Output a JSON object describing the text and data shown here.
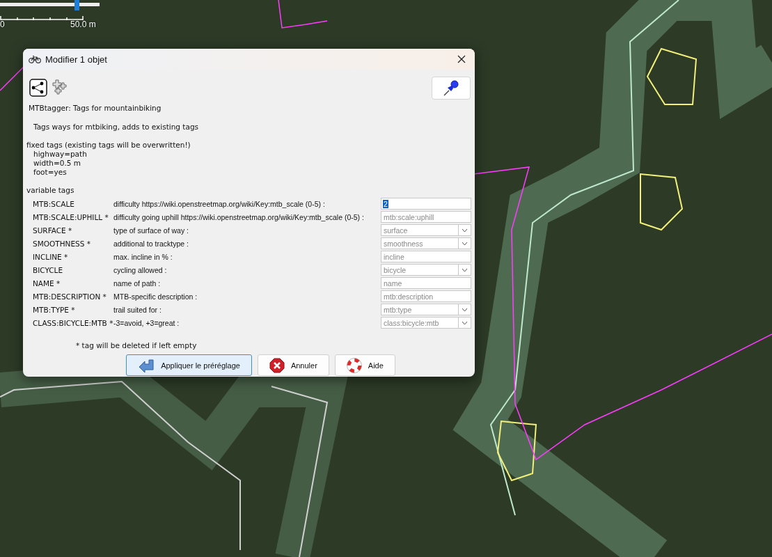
{
  "map": {
    "zoom_slider": {
      "level": 0.77
    },
    "scale": {
      "start": "0",
      "end": "50.0 m"
    }
  },
  "dialog": {
    "title": "Modifier 1 objet",
    "sticky": true,
    "heading": "MTBtagger: Tags for mountainbiking",
    "description": "Tags ways for mtbiking, adds to existing tags",
    "fixed_title": "fixed tags (existing tags will be overwritten!)",
    "fixed_tags": [
      "highway=path",
      "width=0.5 m",
      "foot=yes"
    ],
    "variable_title": "variable tags",
    "rows": [
      {
        "key": "MTB:SCALE",
        "label": "difficulty https://wiki.openstreetmap.org/wiki/Key:mtb_scale (0-5) :",
        "kind": "text",
        "value": "2",
        "selected": true
      },
      {
        "key": "MTB:SCALE:UPHILL *",
        "label": "difficulty going uphill https://wiki.openstreetmap.org/wiki/Key:mtb_scale (0-5) :",
        "kind": "text",
        "placeholder": "mtb:scale:uphill",
        "selected": false
      },
      {
        "key": "SURFACE *",
        "label": "type of surface of way :",
        "kind": "combo",
        "placeholder": "surface",
        "selected": false
      },
      {
        "key": "SMOOTHNESS *",
        "label": "additional to tracktype :",
        "kind": "combo",
        "placeholder": "smoothness",
        "selected": false
      },
      {
        "key": "INCLINE *",
        "label": "max. incline in % :",
        "kind": "text",
        "placeholder": "incline",
        "selected": false
      },
      {
        "key": "BICYCLE",
        "label": "cycling allowed :",
        "kind": "combo",
        "placeholder": "bicycle",
        "selected": false
      },
      {
        "key": "NAME *",
        "label": "name of path :",
        "kind": "text",
        "placeholder": "name",
        "selected": false
      },
      {
        "key": "MTB:DESCRIPTION *",
        "label": "MTB-specific description :",
        "kind": "text",
        "placeholder": "mtb:description",
        "selected": false
      },
      {
        "key": "MTB:TYPE *",
        "label": "trail suited for :",
        "kind": "combo",
        "placeholder": "mtb:type",
        "selected": false
      },
      {
        "key": "CLASS:BICYCLE:MTB *",
        "label": "-3=avoid, +3=great :",
        "kind": "combo",
        "placeholder": "class:bicycle:mtb",
        "selected": false
      }
    ],
    "footnote": "* tag will be deleted if left empty",
    "buttons": [
      {
        "label": "Appliquer le préréglage",
        "kind": "apply",
        "default": true
      },
      {
        "label": "Annuler",
        "kind": "cancel",
        "default": false
      },
      {
        "label": "Aide",
        "kind": "help",
        "default": false
      }
    ]
  }
}
